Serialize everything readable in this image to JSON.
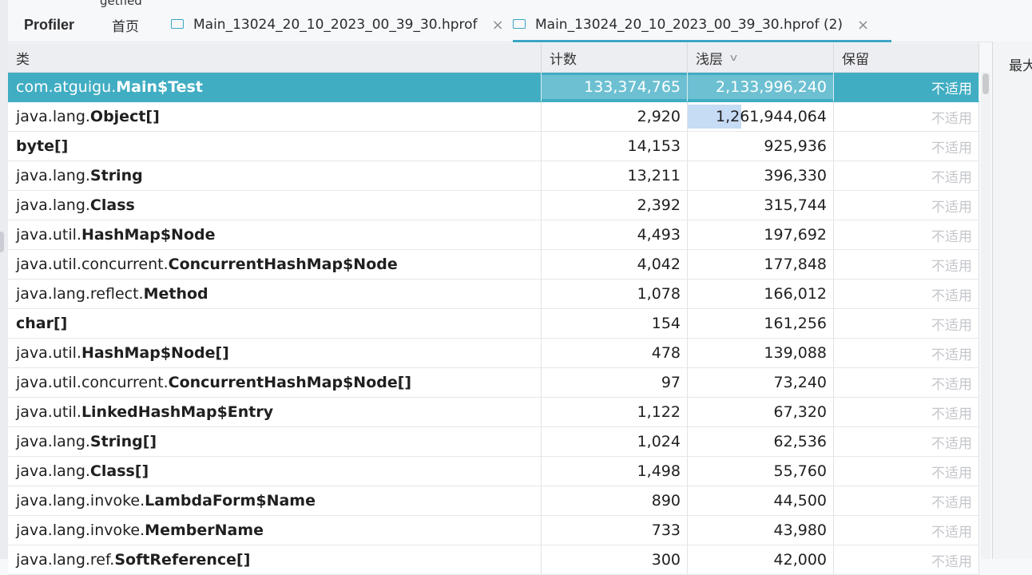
{
  "top_partial_text": "getfied",
  "tabs": {
    "profiler": "Profiler",
    "home": "首页",
    "file1": "Main_13024_20_10_2023_00_39_30.hprof",
    "file2": "Main_13024_20_10_2023_00_39_30.hprof (2)",
    "close_glyph": "×"
  },
  "columns": {
    "class": "类",
    "count": "计数",
    "shallow": "浅层",
    "retained": "保留"
  },
  "right_panel_label": "最大",
  "rows": [
    {
      "pkg": "com.atguigu.",
      "cls": "Main$Test",
      "count": "133,374,765",
      "shallow": "2,133,996,240",
      "retained": "不适用",
      "count_share": 1.0,
      "shallow_share": 1.0
    },
    {
      "pkg": "java.lang.",
      "cls": "Object[]",
      "count": "2,920",
      "shallow": "1,261,944,064",
      "retained": "不适用",
      "shallow_share": 0.37
    },
    {
      "pkg": "",
      "cls": "byte[]",
      "count": "14,153",
      "shallow": "925,936",
      "retained": "不适用"
    },
    {
      "pkg": "java.lang.",
      "cls": "String",
      "count": "13,211",
      "shallow": "396,330",
      "retained": "不适用"
    },
    {
      "pkg": "java.lang.",
      "cls": "Class",
      "count": "2,392",
      "shallow": "315,744",
      "retained": "不适用"
    },
    {
      "pkg": "java.util.",
      "cls": "HashMap$Node",
      "count": "4,493",
      "shallow": "197,692",
      "retained": "不适用"
    },
    {
      "pkg": "java.util.concurrent.",
      "cls": "ConcurrentHashMap$Node",
      "count": "4,042",
      "shallow": "177,848",
      "retained": "不适用"
    },
    {
      "pkg": "java.lang.reflect.",
      "cls": "Method",
      "count": "1,078",
      "shallow": "166,012",
      "retained": "不适用"
    },
    {
      "pkg": "",
      "cls": "char[]",
      "count": "154",
      "shallow": "161,256",
      "retained": "不适用"
    },
    {
      "pkg": "java.util.",
      "cls": "HashMap$Node[]",
      "count": "478",
      "shallow": "139,088",
      "retained": "不适用"
    },
    {
      "pkg": "java.util.concurrent.",
      "cls": "ConcurrentHashMap$Node[]",
      "count": "97",
      "shallow": "73,240",
      "retained": "不适用"
    },
    {
      "pkg": "java.util.",
      "cls": "LinkedHashMap$Entry",
      "count": "1,122",
      "shallow": "67,320",
      "retained": "不适用"
    },
    {
      "pkg": "java.lang.",
      "cls": "String[]",
      "count": "1,024",
      "shallow": "62,536",
      "retained": "不适用"
    },
    {
      "pkg": "java.lang.",
      "cls": "Class[]",
      "count": "1,498",
      "shallow": "55,760",
      "retained": "不适用"
    },
    {
      "pkg": "java.lang.invoke.",
      "cls": "LambdaForm$Name",
      "count": "890",
      "shallow": "44,500",
      "retained": "不适用"
    },
    {
      "pkg": "java.lang.invoke.",
      "cls": "MemberName",
      "count": "733",
      "shallow": "43,980",
      "retained": "不适用"
    },
    {
      "pkg": "java.lang.ref.",
      "cls": "SoftReference[]",
      "count": "300",
      "shallow": "42,000",
      "retained": "不适用"
    }
  ],
  "colors": {
    "selected_row": "#41adc3",
    "share_bar": "#c6dbf4",
    "accent": "#3aa5c4"
  }
}
